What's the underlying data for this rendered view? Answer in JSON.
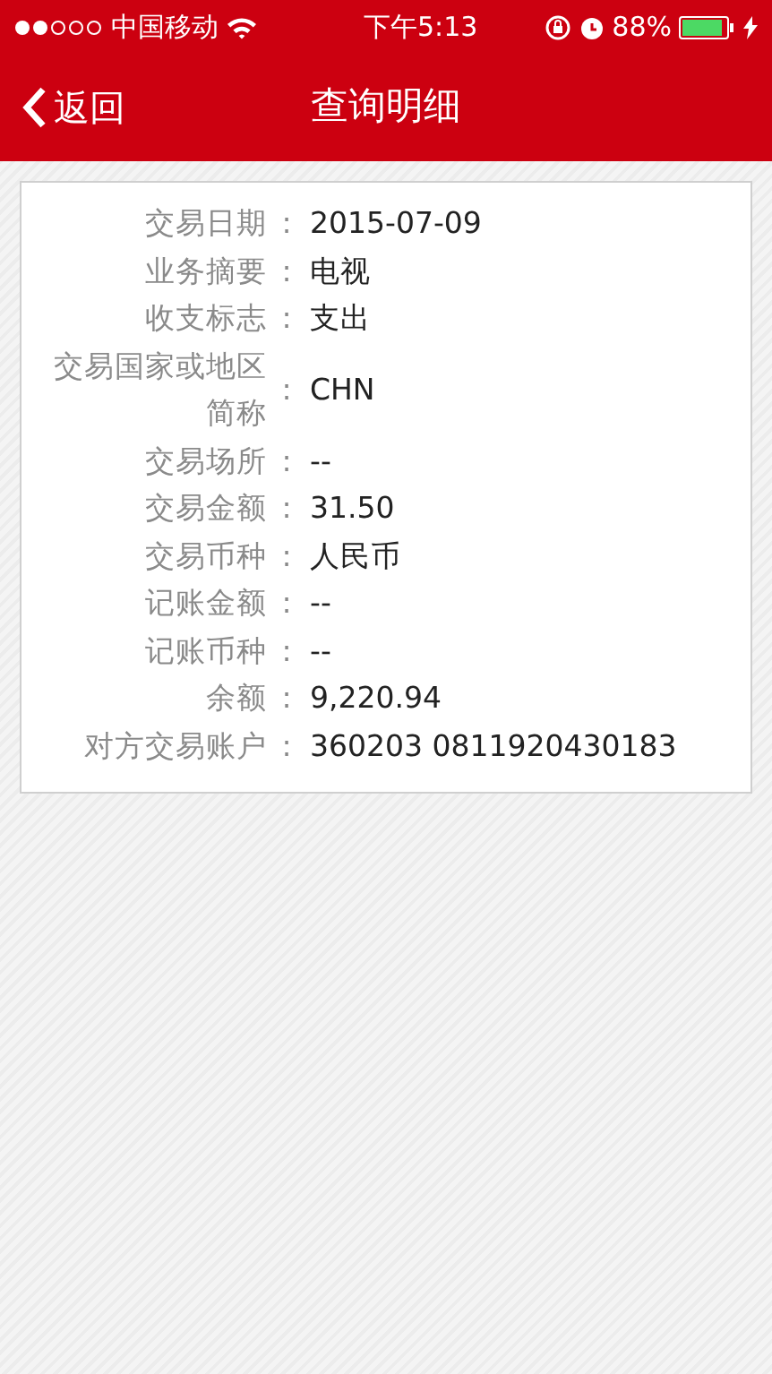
{
  "status_bar": {
    "carrier": "中国移动",
    "time": "下午5:13",
    "battery": "88%"
  },
  "nav_bar": {
    "back": "返回",
    "title": "查询明细"
  },
  "details": [
    {
      "label": "交易日期",
      "separator": ":",
      "value": "2015-07-09"
    },
    {
      "label": "业务摘要",
      "separator": ":",
      "value": "电视"
    },
    {
      "label": "收支标志",
      "separator": ":",
      "value": "支出"
    },
    {
      "label": "交易国家或地区简称",
      "separator": ":",
      "value": "CHN"
    },
    {
      "label": "交易场所",
      "separator": ":",
      "value": "--"
    },
    {
      "label": "交易金额",
      "separator": ":",
      "value": "31.50"
    },
    {
      "label": "交易币种",
      "separator": ":",
      "value": "人民币"
    },
    {
      "label": "记账金额",
      "separator": ":",
      "value": "--"
    },
    {
      "label": "记账币种",
      "separator": ":",
      "value": "--"
    },
    {
      "label": "余额",
      "separator": ":",
      "value": "9,220.94"
    },
    {
      "label": "对方交易账户",
      "separator": ":",
      "value": "360203 0811920430183"
    }
  ]
}
